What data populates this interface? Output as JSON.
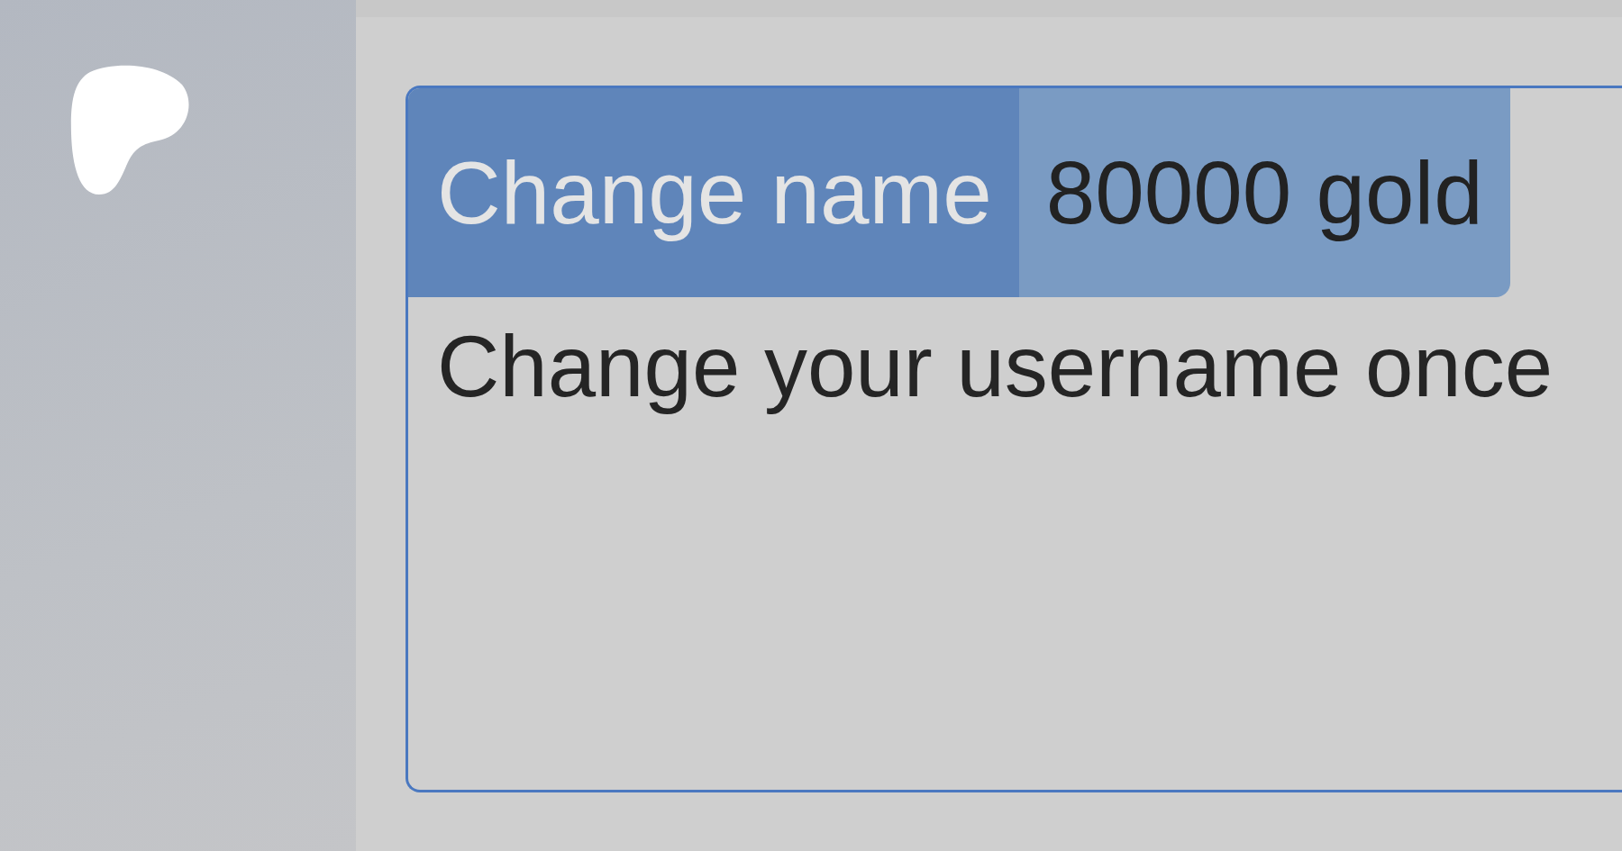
{
  "item": {
    "title": "Change name",
    "price": "80000 gold",
    "description": "Change your username once"
  }
}
